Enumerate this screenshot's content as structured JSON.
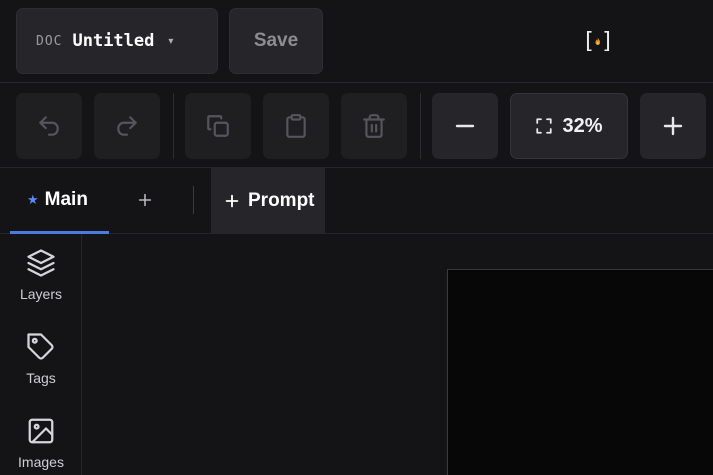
{
  "header": {
    "doc_tag": "DOC",
    "doc_name": "Untitled",
    "doc_caret": "▾",
    "save_label": "Save",
    "logo_left": "[",
    "logo_right": "]"
  },
  "toolbar": {
    "icons": [
      "undo-icon",
      "redo-icon",
      "copy-icon",
      "paste-icon",
      "trash-icon",
      "zoom-out-icon",
      "fit-icon",
      "zoom-in-icon"
    ],
    "zoom_value": "32%"
  },
  "tabs": {
    "main_star": "★",
    "main_label": "Main",
    "prompt_label": "Prompt"
  },
  "sidebar": {
    "items": [
      {
        "label": "Layers",
        "icon": "layers-icon"
      },
      {
        "label": "Tags",
        "icon": "tag-icon"
      },
      {
        "label": "Images",
        "icon": "image-icon"
      }
    ]
  },
  "colors": {
    "accent": "#4a7be0",
    "background": "#141416",
    "panel": "#26262a",
    "flame": "#e8902a"
  }
}
